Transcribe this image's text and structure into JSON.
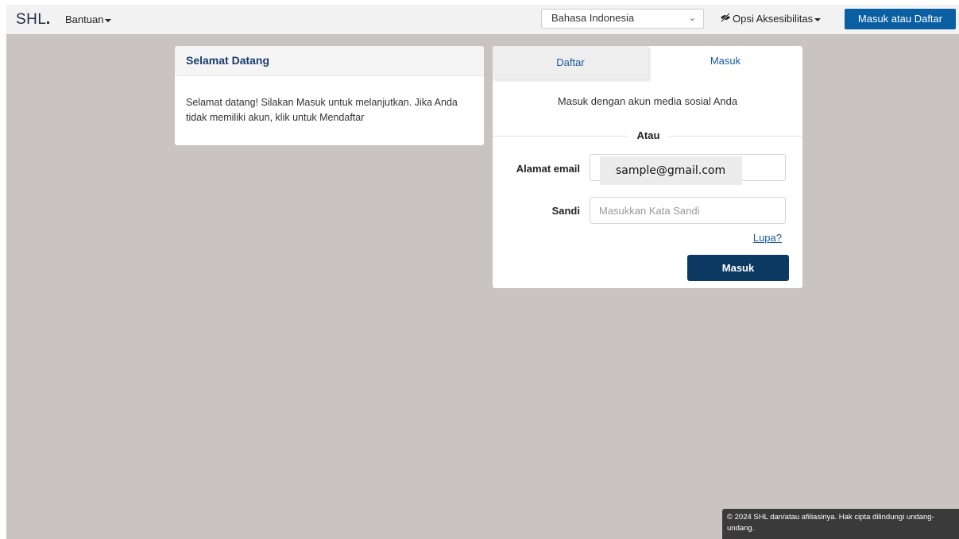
{
  "header": {
    "logo": "SHL",
    "help_menu": "Bantuan",
    "language": "Bahasa Indonesia",
    "accessibility_menu": "Opsi Aksesibilitas",
    "login_register_button": "Masuk atau Daftar"
  },
  "welcome": {
    "title": "Selamat Datang",
    "body": "Selamat datang! Silakan Masuk untuk melanjutkan. Jika Anda tidak memiliki akun, klik untuk Mendaftar"
  },
  "login": {
    "tabs": [
      {
        "label": "Daftar"
      },
      {
        "label": "Masuk"
      }
    ],
    "social_text": "Masuk dengan akun media sosial Anda",
    "or_text": "Atau",
    "email_label": "Alamat email",
    "email_value": "sample@gmail.com",
    "password_label": "Sandi",
    "password_placeholder": "Masukkan Kata Sandi",
    "forgot_link": "Lupa?",
    "submit_button": "Masuk"
  },
  "footer": {
    "text": "© 2024 SHL dan/atau afiliasinya. Hak cipta dilindungi undang-undang."
  }
}
